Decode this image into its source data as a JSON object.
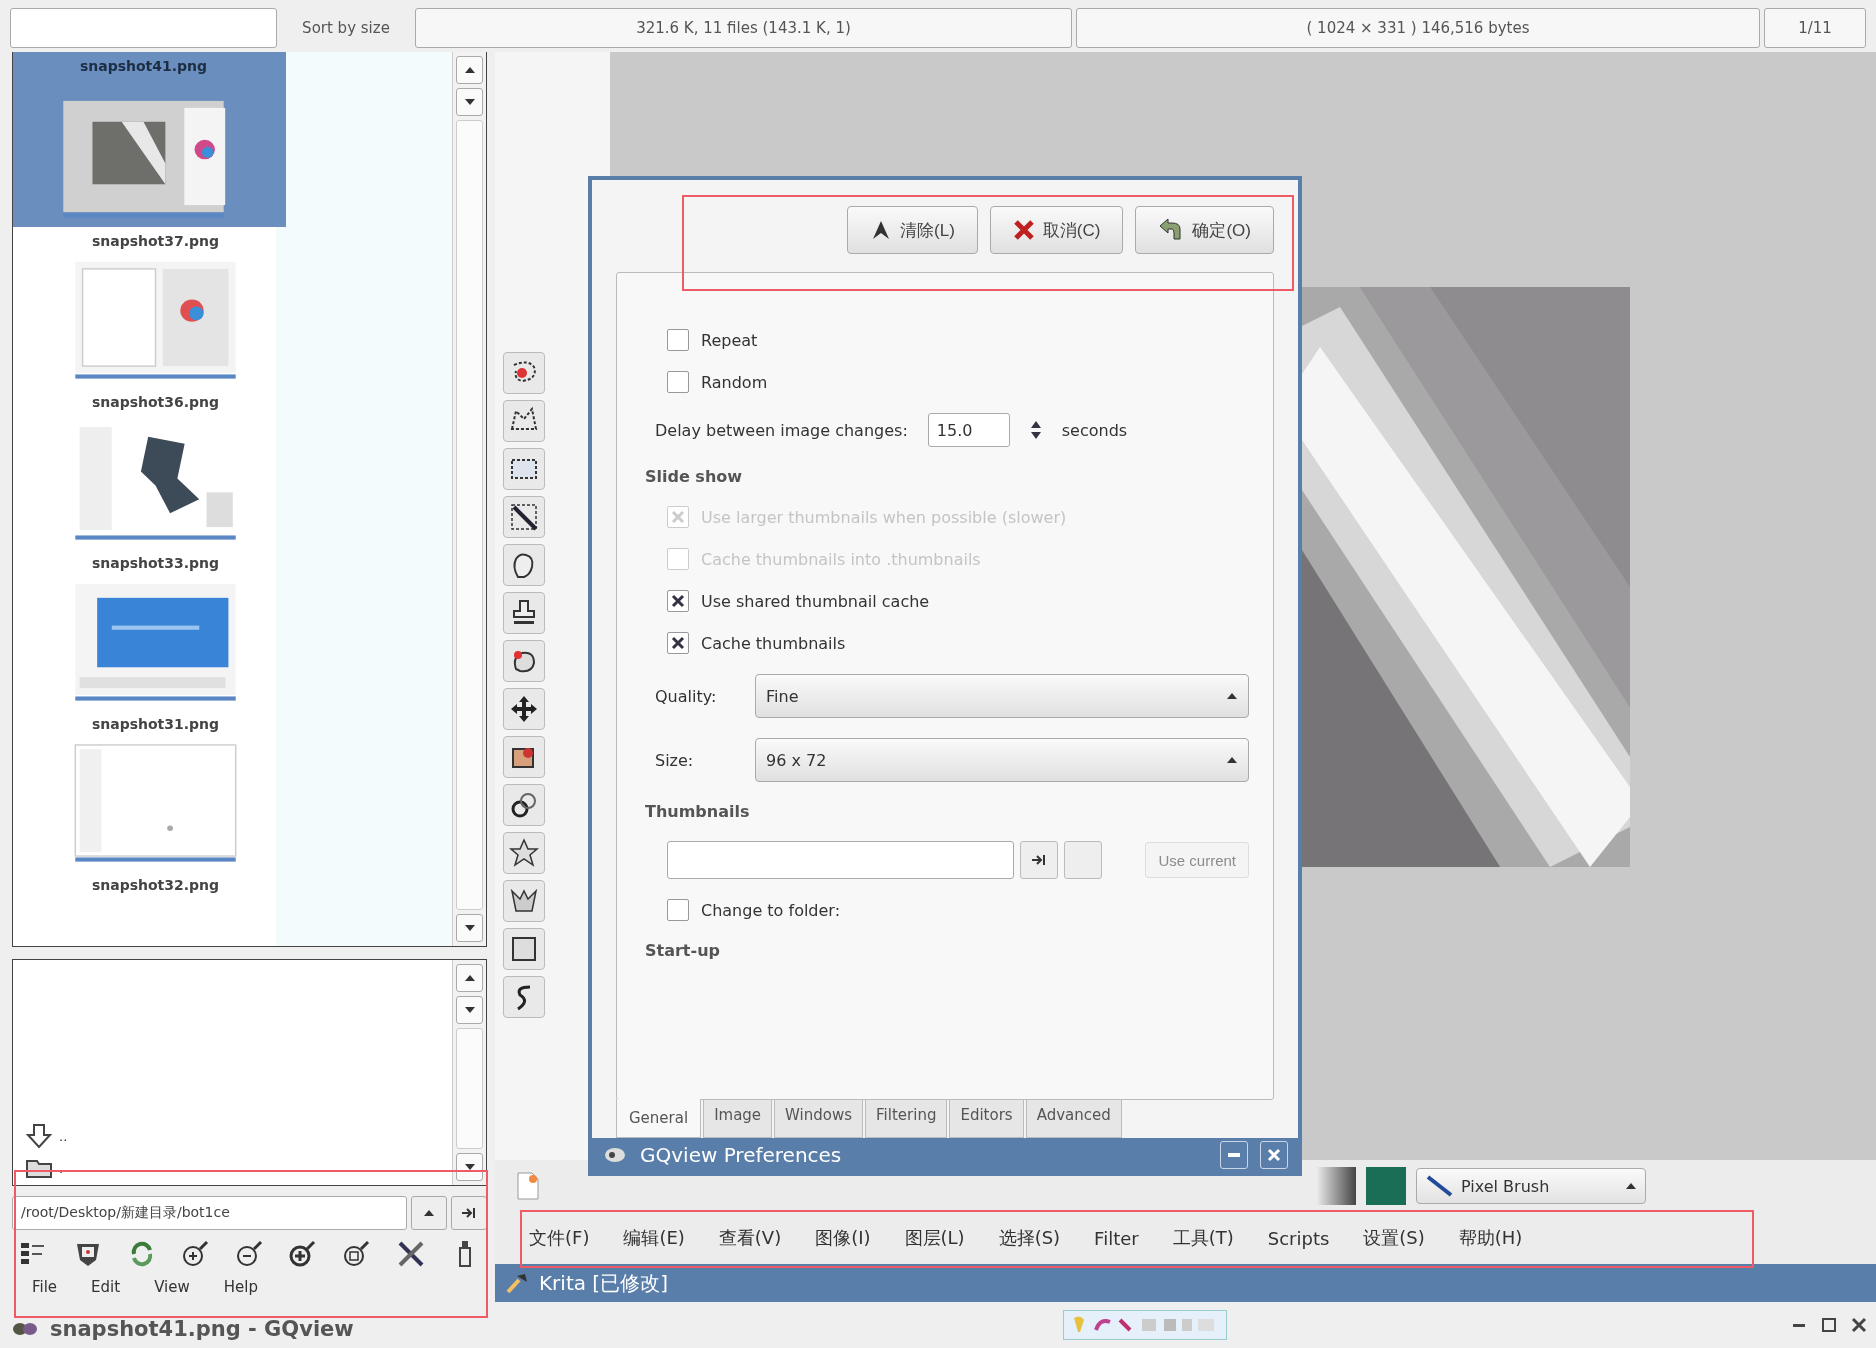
{
  "status_bar": {
    "sort_label": "Sort by size",
    "file_info": "321.6 K, 11 files (143.1 K, 1)",
    "image_info": "( 1024 × 331 ) 146,516 bytes",
    "index": "1/11"
  },
  "file_browser": {
    "thumbnails": [
      {
        "name": "snapshot41.png",
        "selected": true,
        "kind": "picture"
      },
      {
        "name": "snapshot37.png",
        "selected": false,
        "kind": "picture"
      },
      {
        "name": "snapshot36.png",
        "selected": false,
        "kind": "picture"
      },
      {
        "name": "snapshot33.png",
        "selected": false,
        "kind": "picture"
      },
      {
        "name": "snapshot31.png",
        "selected": false,
        "kind": "picture"
      },
      {
        "name": "snapshot32.png",
        "selected": false,
        "kind": "label"
      }
    ],
    "folders": [
      "..",
      "."
    ],
    "path": "/root/Desktop/新建目录/bot1ce",
    "menu": [
      "File",
      "Edit",
      "View",
      "Help"
    ],
    "title": "snapshot41.png - GQview"
  },
  "preferences": {
    "title": "GQview Preferences",
    "buttons": [
      "清除(L)",
      "取消(C)",
      "确定(O)"
    ],
    "rows": [
      {
        "kind": "checkbox",
        "label": "Repeat",
        "checked": false,
        "disabled": false
      },
      {
        "kind": "checkbox",
        "label": "Random",
        "checked": false,
        "disabled": false
      },
      {
        "kind": "spin",
        "label": "Delay between image changes:",
        "value": "15.0",
        "unit": "seconds"
      },
      {
        "kind": "heading",
        "label": "Slide show"
      },
      {
        "kind": "checkbox",
        "label": "Use larger thumbnails when possible (slower)",
        "checked": true,
        "disabled": true
      },
      {
        "kind": "checkbox",
        "label": "Cache thumbnails into .thumbnails",
        "checked": false,
        "disabled": true
      },
      {
        "kind": "checkbox",
        "label": "Use shared thumbnail cache",
        "checked": true,
        "disabled": false
      },
      {
        "kind": "checkbox",
        "label": "Cache thumbnails",
        "checked": true,
        "disabled": false
      },
      {
        "kind": "select",
        "label": "Quality:",
        "value": "Fine"
      },
      {
        "kind": "select",
        "label": "Size:",
        "value": "96 x 72"
      },
      {
        "kind": "heading",
        "label": "Thumbnails"
      },
      {
        "kind": "folder",
        "button": "Use current"
      },
      {
        "kind": "checkbox",
        "label": "Change to folder:",
        "checked": false,
        "disabled": false
      },
      {
        "kind": "heading",
        "label": "Start-up"
      }
    ],
    "tabs": [
      {
        "label": "General",
        "selected": true
      },
      {
        "label": "Image",
        "selected": false
      },
      {
        "label": "Windows",
        "selected": false
      },
      {
        "label": "Filtering",
        "selected": false
      },
      {
        "label": "Editors",
        "selected": false
      },
      {
        "label": "Advanced",
        "selected": false
      }
    ]
  },
  "krita": {
    "brush": "Pixel Brush",
    "menu": [
      "文件(F)",
      "编辑(E)",
      "查看(V)",
      "图像(I)",
      "图层(L)",
      "选择(S)",
      "Filter",
      "工具(T)",
      "Scripts",
      "设置(S)",
      "帮助(H)"
    ],
    "title": "Krita [已修改]"
  }
}
